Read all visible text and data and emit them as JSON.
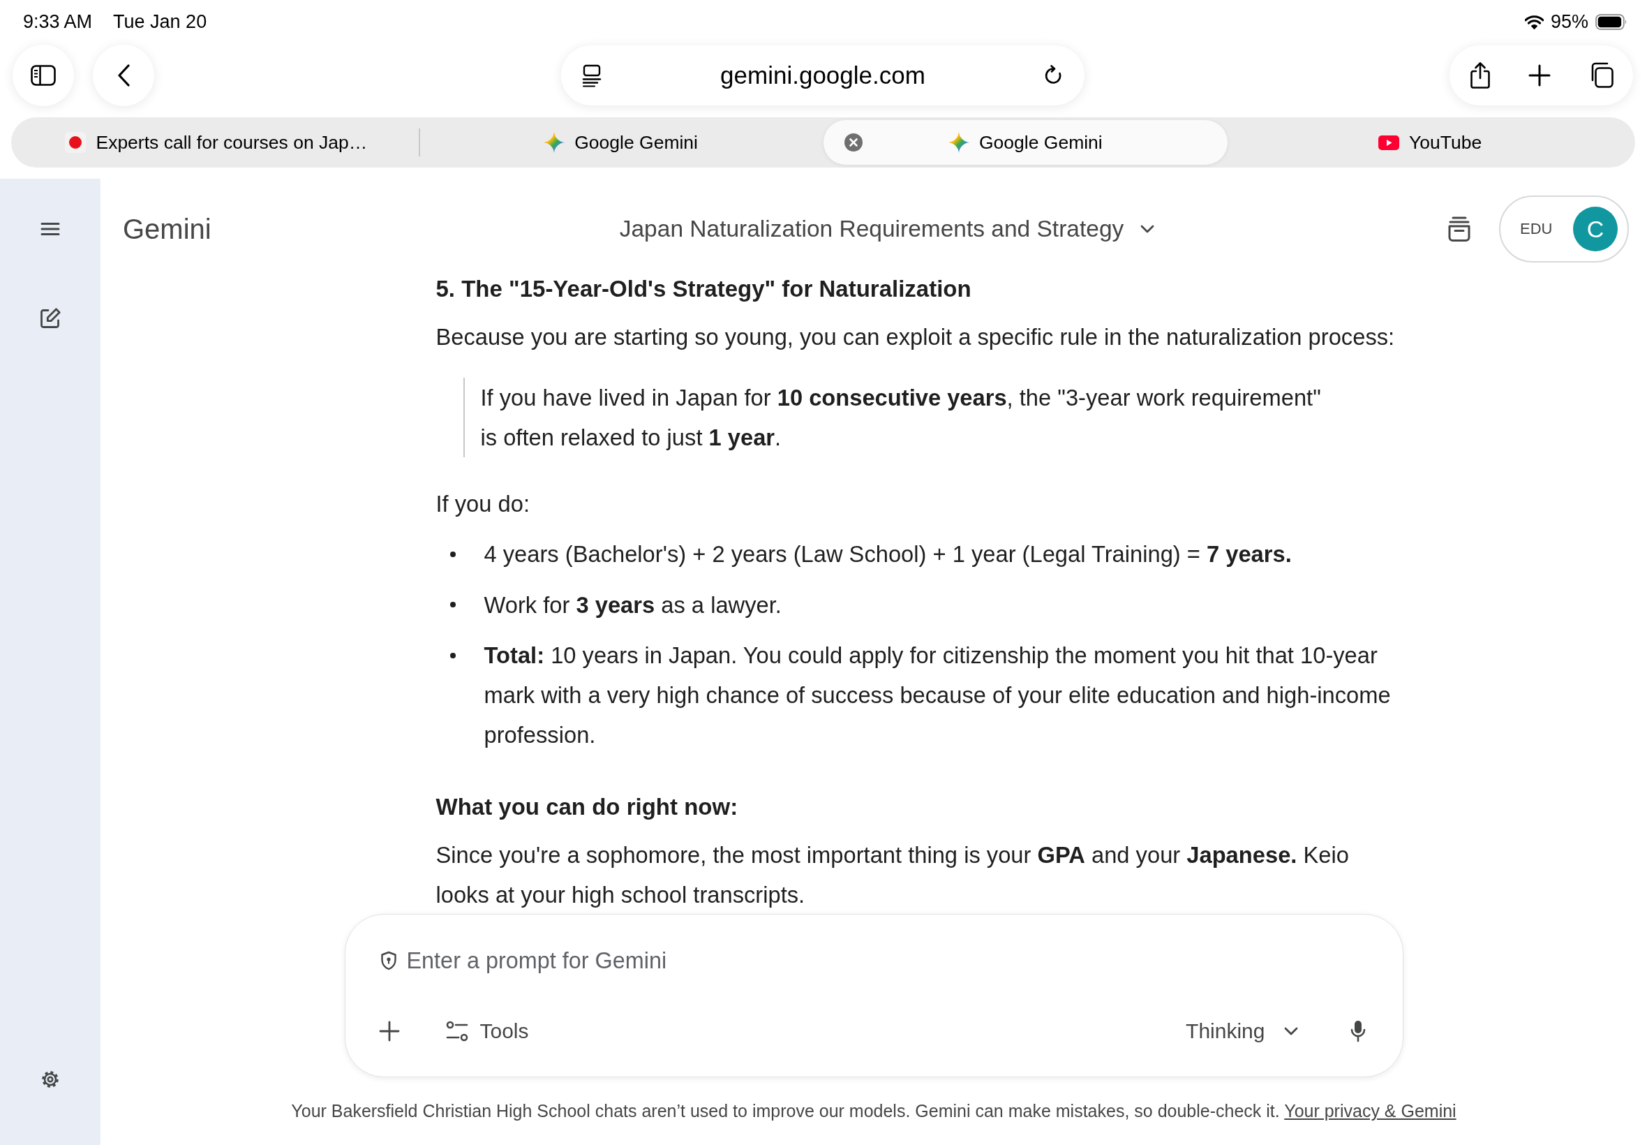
{
  "status_bar": {
    "time": "9:33 AM",
    "date": "Tue Jan 20",
    "battery": "95%"
  },
  "browser": {
    "url": "gemini.google.com",
    "tabs": [
      {
        "title": "Experts call for courses on Jap…",
        "kind": "dot",
        "selected": false
      },
      {
        "title": "Google Gemini",
        "kind": "sparkle",
        "selected": false
      },
      {
        "title": "Google Gemini",
        "kind": "sparkle",
        "selected": true
      },
      {
        "title": "YouTube",
        "kind": "play",
        "selected": false
      }
    ]
  },
  "header": {
    "app_name": "Gemini",
    "conversation_title": "Japan Naturalization Requirements and Strategy",
    "account_badge": "EDU",
    "avatar_initial": "C"
  },
  "response": [
    {
      "kind": "heading",
      "text": "5. The \"15-Year-Old's Strategy\" for Naturalization"
    },
    {
      "kind": "paragraph",
      "text": "Because you are starting so young, you can exploit a specific rule in the naturalization process:"
    },
    {
      "kind": "quote",
      "text": "If you have lived in Japan for **10 consecutive years**, the \"3-year work requirement\" is often relaxed to just **1 year**."
    },
    {
      "kind": "paragraph",
      "text": "If you do:"
    },
    {
      "kind": "bullets",
      "items": [
        "4 years (Bachelor's) + 2 years (Law School) + 1 year (Legal Training) = **7 years.**",
        "Work for **3 years** as a lawyer.",
        "**Total:** 10 years in Japan. You could apply for citizenship the moment you hit that 10-year mark with a very high chance of success because of your elite education and high-income profession."
      ]
    },
    {
      "kind": "heading",
      "text": "What you can do right now:"
    },
    {
      "kind": "paragraph",
      "text": "Since you're a sophomore, the most important thing is your **GPA** and your **Japanese.** Keio looks at your high school transcripts."
    }
  ],
  "prompt": {
    "placeholder": "Enter a prompt for Gemini",
    "tools_label": "Tools",
    "mode": "Thinking"
  },
  "footer": {
    "notice": "Your Bakersfield Christian High School chats aren’t used to improve our models. Gemini can make mistakes, so double-check it.",
    "link": "Your privacy & Gemini"
  }
}
